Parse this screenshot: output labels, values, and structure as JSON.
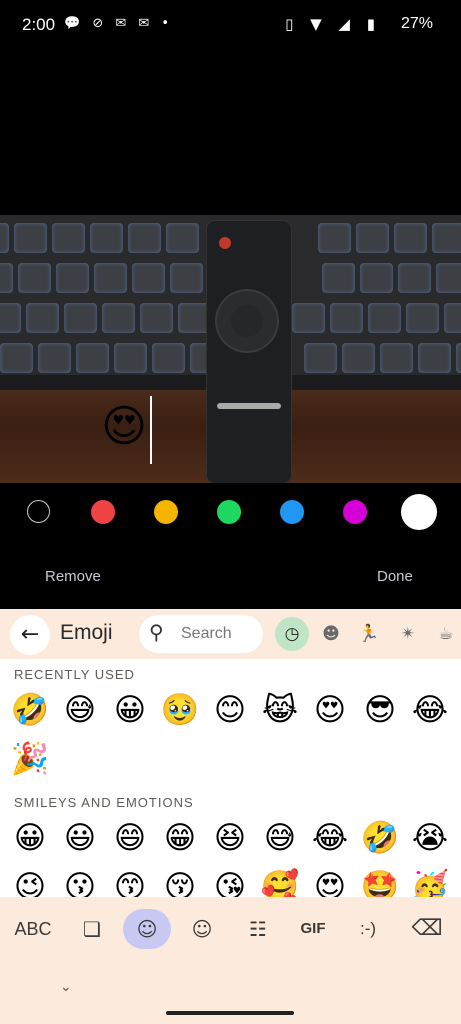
{
  "status_bar": {
    "time": "2:00",
    "notif_icons": "💬 ⊘ ✉ ✉ •",
    "system_icons": "▯ ▼ ◢ ▮",
    "battery": "27%"
  },
  "editor": {
    "sticker_emoji": "😍",
    "colors": [
      "#000000",
      "#f04444",
      "#f4b400",
      "#1ed760",
      "#2196f3",
      "#d500d5",
      "#ffffff"
    ],
    "remove_label": "Remove",
    "done_label": "Done"
  },
  "keyboard": {
    "back_icon": "←",
    "title": "Emoji",
    "search_placeholder": "Search",
    "categories": [
      "recent-icon",
      "smileys-icon",
      "people-icon",
      "celebration-icon",
      "food-icon"
    ],
    "accent_color": "#bfe5c6",
    "sections": [
      {
        "title": "RECENTLY USED",
        "emojis": [
          "🤣",
          "😅",
          "😀",
          "🥹",
          "😊",
          "😹",
          "😍",
          "😎",
          "😂",
          "🎉"
        ]
      },
      {
        "title": "SMILEYS AND EMOTIONS",
        "emojis": [
          "😀",
          "😃",
          "😄",
          "😁",
          "😆",
          "😅",
          "😂",
          "🤣",
          "😭",
          "😉",
          "😗",
          "😙",
          "😚",
          "😘",
          "🥰",
          "😍",
          "🤩",
          "🥳"
        ]
      }
    ],
    "bottom_bar": {
      "abc": "ABC",
      "gif": "GIF",
      "emoticon": ":-)"
    }
  }
}
